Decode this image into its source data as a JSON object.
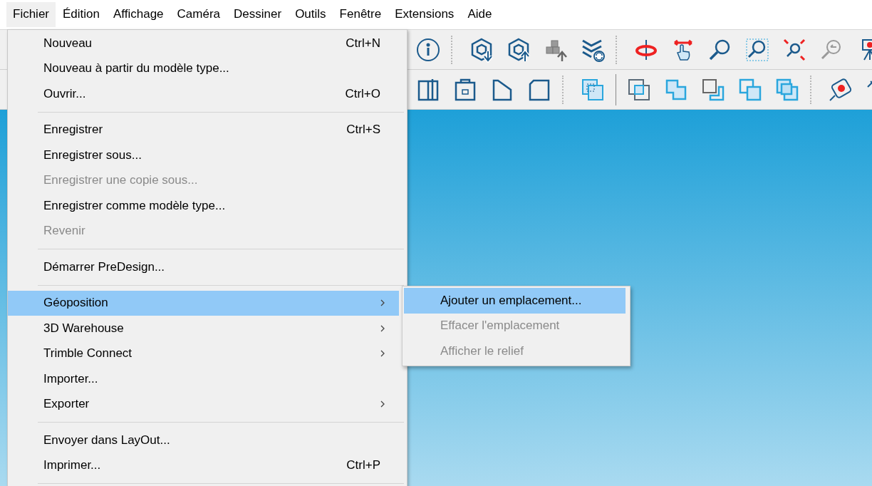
{
  "menubar": [
    {
      "label": "Fichier",
      "selected": true
    },
    {
      "label": "Édition",
      "selected": false
    },
    {
      "label": "Affichage",
      "selected": false
    },
    {
      "label": "Caméra",
      "selected": false
    },
    {
      "label": "Dessiner",
      "selected": false
    },
    {
      "label": "Outils",
      "selected": false
    },
    {
      "label": "Fenêtre",
      "selected": false
    },
    {
      "label": "Extensions",
      "selected": false
    },
    {
      "label": "Aide",
      "selected": false
    }
  ],
  "file_menu": {
    "sections": [
      [
        {
          "label": "Nouveau",
          "shortcut": "Ctrl+N",
          "disabled": false,
          "submenu": false,
          "selected": false
        },
        {
          "label": "Nouveau à partir du modèle type...",
          "disabled": false,
          "submenu": false,
          "selected": false
        },
        {
          "label": "Ouvrir...",
          "shortcut": "Ctrl+O",
          "disabled": false,
          "submenu": false,
          "selected": false
        }
      ],
      [
        {
          "label": "Enregistrer",
          "shortcut": "Ctrl+S",
          "disabled": false,
          "submenu": false,
          "selected": false
        },
        {
          "label": "Enregistrer sous...",
          "disabled": false,
          "submenu": false,
          "selected": false
        },
        {
          "label": "Enregistrer une copie sous...",
          "disabled": true,
          "submenu": false,
          "selected": false
        },
        {
          "label": "Enregistrer comme modèle type...",
          "disabled": false,
          "submenu": false,
          "selected": false
        },
        {
          "label": "Revenir",
          "disabled": true,
          "submenu": false,
          "selected": false
        }
      ],
      [
        {
          "label": "Démarrer PreDesign...",
          "disabled": false,
          "submenu": false,
          "selected": false
        }
      ],
      [
        {
          "label": "Géoposition",
          "disabled": false,
          "submenu": true,
          "selected": true
        },
        {
          "label": "3D Warehouse",
          "disabled": false,
          "submenu": true,
          "selected": false
        },
        {
          "label": "Trimble Connect",
          "disabled": false,
          "submenu": true,
          "selected": false
        },
        {
          "label": "Importer...",
          "disabled": false,
          "submenu": false,
          "selected": false
        },
        {
          "label": "Exporter",
          "disabled": false,
          "submenu": true,
          "selected": false
        }
      ],
      [
        {
          "label": "Envoyer dans LayOut...",
          "disabled": false,
          "submenu": false,
          "selected": false
        },
        {
          "label": "Imprimer...",
          "shortcut": "Ctrl+P",
          "disabled": false,
          "submenu": false,
          "selected": false
        }
      ]
    ]
  },
  "submenu": {
    "items": [
      {
        "label": "Ajouter un emplacement...",
        "disabled": false,
        "selected": true
      },
      {
        "label": "Effacer l'emplacement",
        "disabled": true,
        "selected": false
      },
      {
        "label": "Afficher le relief",
        "disabled": true,
        "selected": false
      }
    ]
  }
}
